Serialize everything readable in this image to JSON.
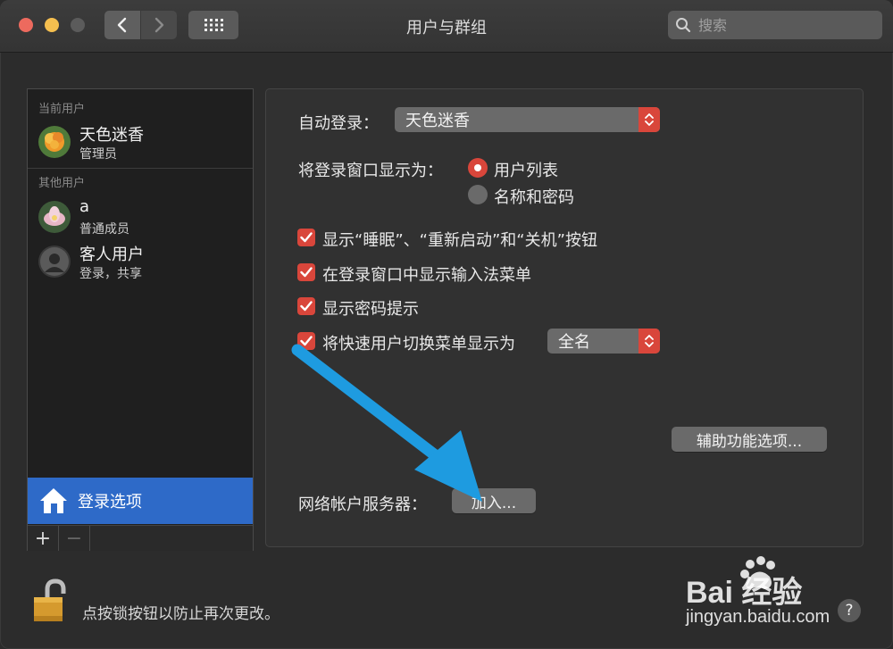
{
  "window": {
    "title": "用户与群组",
    "search_placeholder": "搜索"
  },
  "sidebar": {
    "current_users_label": "当前用户",
    "other_users_label": "其他用户",
    "current_user": {
      "name": "天色迷香",
      "role": "管理员"
    },
    "other_users": [
      {
        "name": "a",
        "role": "普通成员"
      },
      {
        "name": "客人用户",
        "role": "登录，共享"
      }
    ],
    "login_options_label": "登录选项",
    "add_symbol": "+",
    "remove_symbol": "−"
  },
  "panel": {
    "auto_login_label": "自动登录：",
    "auto_login_value": "天色迷香",
    "display_login_window_label": "将登录窗口显示为：",
    "radio_user_list": "用户列表",
    "radio_name_password": "名称和密码",
    "radio_selected": "用户列表",
    "checkboxes": [
      {
        "label": "显示“睡眠”、“重新启动”和“关机”按钮",
        "checked": true
      },
      {
        "label": "在登录窗口中显示输入法菜单",
        "checked": true
      },
      {
        "label": "显示密码提示",
        "checked": true
      },
      {
        "label": "将快速用户切换菜单显示为",
        "checked": true
      }
    ],
    "fast_switch_value": "全名",
    "accessibility_button": "辅助功能选项...",
    "network_server_label": "网络帐户服务器：",
    "join_button": "加入..."
  },
  "footer": {
    "lock_text": "点按锁按钮以防止再次更改。",
    "help_label": "?"
  },
  "watermark": {
    "brand": "Bai  经验",
    "url": "jingyan.baidu.com"
  },
  "colors": {
    "accent": "#d9463b",
    "selection": "#2e6ac8",
    "arrow": "#1e9be0"
  }
}
